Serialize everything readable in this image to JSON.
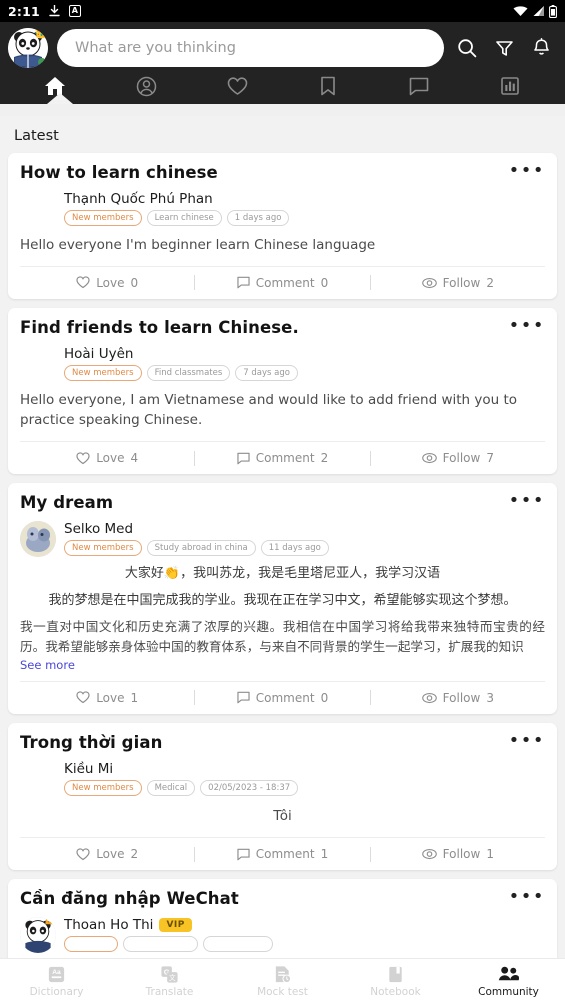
{
  "status_bar": {
    "time": "2:11",
    "left_icons": [
      "download-icon",
      "a-box-icon"
    ],
    "right_icons": [
      "wifi-icon",
      "signal-icon",
      "battery-icon"
    ]
  },
  "header": {
    "logo": "panda-avatar-logo",
    "search_placeholder": "What are you thinking",
    "icons": [
      {
        "name": "search-icon"
      },
      {
        "name": "filter-icon"
      },
      {
        "name": "notification-bell-icon"
      }
    ]
  },
  "top_tabs": [
    {
      "name": "home",
      "icon": "home-icon",
      "active": true
    },
    {
      "name": "profile",
      "icon": "profile-circle-icon",
      "active": false
    },
    {
      "name": "favorites",
      "icon": "heart-icon",
      "active": false
    },
    {
      "name": "bookmarks",
      "icon": "bookmark-icon",
      "active": false
    },
    {
      "name": "messages",
      "icon": "chat-bubble-icon",
      "active": false
    },
    {
      "name": "statistics",
      "icon": "chart-bar-icon",
      "active": false
    }
  ],
  "feed": {
    "section_title": "Latest",
    "posts": [
      {
        "title": "How to learn chinese",
        "author": "Thạnh Quốc Phú Phan",
        "has_avatar": false,
        "vip": false,
        "tags": [
          "New members",
          "Learn chinese",
          "1 days ago"
        ],
        "body": "Hello everyone I'm beginner learn Chinese language",
        "love_label": "Love",
        "love_count": "0",
        "comment_label": "Comment",
        "comment_count": "0",
        "follow_label": "Follow",
        "follow_count": "2"
      },
      {
        "title": "Find friends to learn Chinese.",
        "author": "Hoài Uyên",
        "has_avatar": false,
        "vip": false,
        "tags": [
          "New members",
          "Find classmates",
          "7 days ago"
        ],
        "body": "Hello everyone, I am Vietnamese and would like to add friend with you to practice speaking Chinese.",
        "love_label": "Love",
        "love_count": "4",
        "comment_label": "Comment",
        "comment_count": "2",
        "follow_label": "Follow",
        "follow_count": "7"
      },
      {
        "title": "My dream",
        "author": "Selko Med",
        "has_avatar": true,
        "vip": false,
        "tags": [
          "New members",
          "Study abroad in china",
          "11 days ago"
        ],
        "body_cn_line1": "大家好👏，我叫苏龙，我是毛里塔尼亚人，我学习汉语",
        "body_cn_line2": "我的梦想是在中国完成我的学业。我现在正在学习中文，希望能够实现这个梦想。",
        "body_cn_para": "我一直对中国文化和历史充满了浓厚的兴趣。我相信在中国学习将给我带来独特而宝贵的经历。我希望能够亲身体验中国的教育体系，与来自不同背景的学生一起学习，扩展我的知识",
        "see_more": "See more",
        "love_label": "Love",
        "love_count": "1",
        "comment_label": "Comment",
        "comment_count": "0",
        "follow_label": "Follow",
        "follow_count": "3"
      },
      {
        "title": "Trong thời gian",
        "author": "Kiều Mi",
        "has_avatar": false,
        "vip": false,
        "tags": [
          "New members",
          "Medical",
          "02/05/2023 - 18:37"
        ],
        "body": "Tôi",
        "love_label": "Love",
        "love_count": "2",
        "comment_label": "Comment",
        "comment_count": "1",
        "follow_label": "Follow",
        "follow_count": "1"
      },
      {
        "title": "Cần đăng nhập  WeChat",
        "author": "Thoan Ho Thi",
        "has_avatar": true,
        "vip": true,
        "vip_label": "VIP",
        "tags": [
          "",
          "",
          ""
        ]
      }
    ]
  },
  "bottom_nav": [
    {
      "label": "Dictionary",
      "icon": "dictionary-icon",
      "active": false
    },
    {
      "label": "Translate",
      "icon": "translate-icon",
      "active": false
    },
    {
      "label": "Mock test",
      "icon": "mock-test-icon",
      "active": false
    },
    {
      "label": "Notebook",
      "icon": "notebook-icon",
      "active": false
    },
    {
      "label": "Community",
      "icon": "community-people-icon",
      "active": true
    }
  ],
  "colors": {
    "header_bg": "#232323",
    "page_bg": "#f2f2f2",
    "card_bg": "#ffffff",
    "accent_orange": "#e08a45",
    "vip_yellow": "#f7c325",
    "link_blue": "#4a47d8"
  }
}
